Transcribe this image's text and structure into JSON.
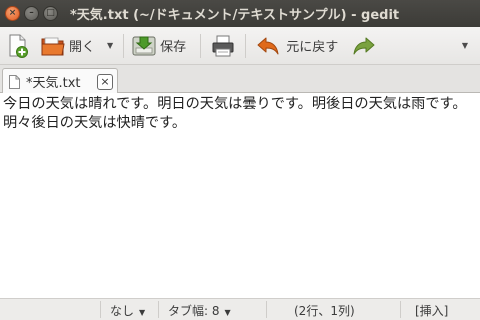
{
  "window": {
    "title": "*天気.txt (~/ドキュメント/テキストサンプル) - gedit",
    "close_glyph": "×",
    "minimize_glyph": "–",
    "maximize_glyph": "□"
  },
  "toolbar": {
    "open_label": "開く",
    "save_label": "保存",
    "undo_label": "元に戻す",
    "dropdown_glyph": "▼"
  },
  "tabs": [
    {
      "label": "*天気.txt",
      "close_glyph": "×",
      "active": true
    }
  ],
  "editor": {
    "text": "今日の天気は晴れです。明日の天気は曇りです。明後日の天気は雨です。明々後日の天気は快晴です。"
  },
  "statusbar": {
    "language": "なし",
    "tab_width": "タブ幅: 8",
    "cursor_position": "(2行、1列)",
    "insert_mode": "[挿入]",
    "dropdown_glyph": "▼"
  },
  "colors": {
    "titlebar": "#3c3b37",
    "close_button": "#e05a20",
    "undo_arrow": "#e06a1b",
    "redo_arrow": "#7aa23f"
  }
}
